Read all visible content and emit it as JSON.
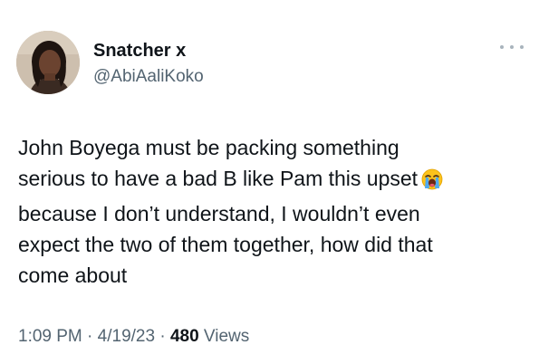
{
  "author": {
    "display_name": "Snatcher x",
    "handle": "@AbiAaliKoko"
  },
  "icons": {
    "avatar": "profile-avatar",
    "more": "more-horizontal-icon",
    "emoji": "loudly-crying-face-emoji"
  },
  "tweet": {
    "lines": [
      "John Boyega must be packing something",
      "serious to have a bad B like Pam this upset",
      "because I don’t understand, I wouldn’t even",
      "expect the two of them together, how did that",
      "come about"
    ]
  },
  "meta": {
    "time": "1:09 PM",
    "sep1": " · ",
    "date": "4/19/23",
    "sep2": " · ",
    "views_count": "480",
    "views_label": " Views"
  },
  "colors": {
    "text": "#0f1419",
    "secondary": "#536471",
    "background": "#ffffff"
  }
}
